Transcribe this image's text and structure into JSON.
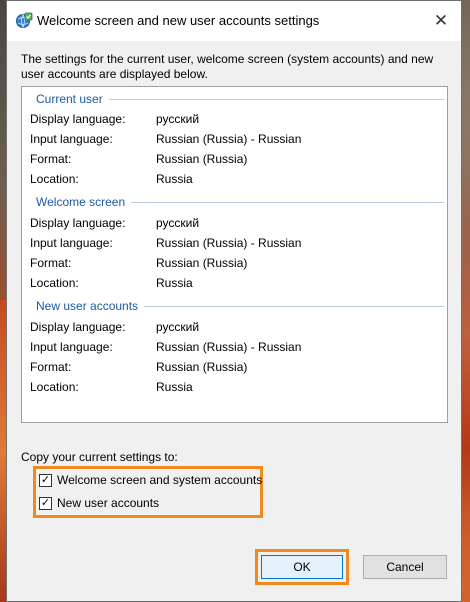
{
  "dialog": {
    "title": "Welcome screen and new user accounts settings",
    "intro": "The settings for the current user, welcome screen (system accounts) and new user accounts are displayed below."
  },
  "sections": [
    {
      "title": "Current user",
      "rows": [
        {
          "label": "Display language:",
          "value": "русский"
        },
        {
          "label": "Input language:",
          "value": "Russian (Russia) - Russian"
        },
        {
          "label": "Format:",
          "value": "Russian (Russia)"
        },
        {
          "label": "Location:",
          "value": "Russia"
        }
      ]
    },
    {
      "title": "Welcome screen",
      "rows": [
        {
          "label": "Display language:",
          "value": "русский"
        },
        {
          "label": "Input language:",
          "value": "Russian (Russia) - Russian"
        },
        {
          "label": "Format:",
          "value": "Russian (Russia)"
        },
        {
          "label": "Location:",
          "value": "Russia"
        }
      ]
    },
    {
      "title": "New user accounts",
      "rows": [
        {
          "label": "Display language:",
          "value": "русский"
        },
        {
          "label": "Input language:",
          "value": "Russian (Russia) - Russian"
        },
        {
          "label": "Format:",
          "value": "Russian (Russia)"
        },
        {
          "label": "Location:",
          "value": "Russia"
        }
      ]
    }
  ],
  "copy": {
    "label": "Copy your current settings to:",
    "options": [
      {
        "label": "Welcome screen and system accounts",
        "checked": true
      },
      {
        "label": "New user accounts",
        "checked": true
      }
    ]
  },
  "buttons": {
    "ok": "OK",
    "cancel": "Cancel"
  },
  "icons": {
    "title": "globe-settings-icon",
    "close": "close-icon"
  },
  "colors": {
    "section_heading": "#1a5aa6",
    "highlight": "#f0891e",
    "ok_border": "#0078d7"
  }
}
